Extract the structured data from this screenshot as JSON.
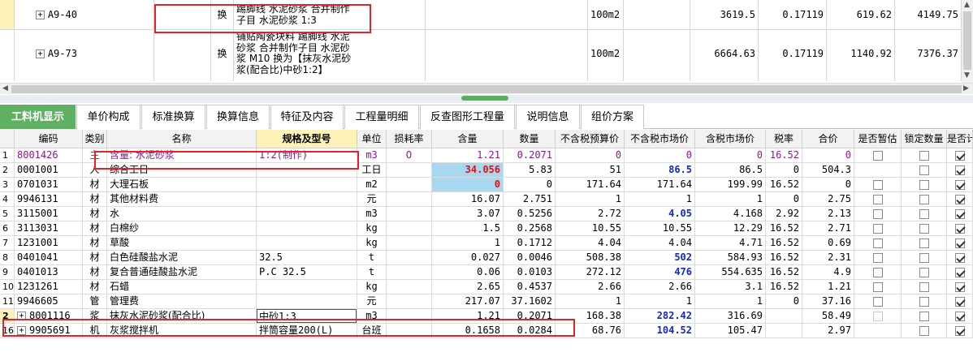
{
  "top_rows": [
    {
      "code": "A9-40",
      "type": "换",
      "name_lines": [
        "踢脚线 水泥砂浆  合并制作",
        "子目 水泥砂浆 1:3"
      ],
      "unit": "100m2",
      "price": "3619.5",
      "qty": "0.17119",
      "total": "619.62",
      "extra": "4149.75"
    },
    {
      "code": "A9-73",
      "type": "换",
      "name_lines": [
        "铺贴陶瓷块料 踢脚线 水泥",
        "砂浆  合并制作子目 水泥砂",
        "浆 M10  换为【抹灰水泥砂",
        "浆(配合比)中砂1:2】"
      ],
      "unit": "100m2",
      "price": "6664.63",
      "qty": "0.17119",
      "total": "1140.92",
      "extra": "7376.37"
    }
  ],
  "tabs": [
    "工料机显示",
    "单价构成",
    "标准换算",
    "换算信息",
    "特征及内容",
    "工程量明细",
    "反查图形工程量",
    "说明信息",
    "组价方案"
  ],
  "active_tab": 0,
  "columns": [
    "编码",
    "类别",
    "名称",
    "规格及型号",
    "单位",
    "损耗率",
    "含量",
    "数量",
    "不含税预算价",
    "不含税市场价",
    "含税市场价",
    "税率",
    "合价",
    "是否暂估",
    "锁定数量",
    "是否计"
  ],
  "rows": [
    {
      "idx": "1",
      "code": "8001426",
      "cat": "主",
      "name": "含量: 水泥砂浆",
      "spec": "1:2(制作)",
      "unit": "m3",
      "loss": "0",
      "content": "1.21",
      "qty": "0.2071",
      "budget": "0",
      "market": "0",
      "market_tax": "0",
      "tax": "16.52",
      "total": "0",
      "est": "checkbox",
      "lock": "checkbox",
      "calc": "checked",
      "style": "purple"
    },
    {
      "idx": "2",
      "code": "0001001",
      "cat": "人",
      "name": "综合工日",
      "spec": "",
      "unit": "工日",
      "loss": "",
      "content": "34.056",
      "qty": "5.83",
      "budget": "51",
      "market": "86.5",
      "market_tax": "86.5",
      "tax": "0",
      "total": "504.3",
      "est": "",
      "lock": "checkbox",
      "calc": "checked",
      "content_style": "red-cyan",
      "market_style": "blue"
    },
    {
      "idx": "3",
      "code": "0701031",
      "cat": "材",
      "name": "大理石板",
      "spec": "",
      "unit": "m2",
      "loss": "",
      "content": "0",
      "qty": "0",
      "budget": "171.64",
      "market": "171.64",
      "market_tax": "199.99",
      "tax": "16.52",
      "total": "0",
      "est": "checkbox",
      "lock": "checkbox",
      "calc": "checked",
      "content_style": "red-cyan"
    },
    {
      "idx": "4",
      "code": "9946131",
      "cat": "材",
      "name": "其他材料费",
      "spec": "",
      "unit": "元",
      "loss": "",
      "content": "16.07",
      "qty": "2.751",
      "budget": "1",
      "market": "1",
      "market_tax": "1",
      "tax": "0",
      "total": "2.75",
      "est": "checkbox",
      "lock": "checkbox",
      "calc": "checked"
    },
    {
      "idx": "5",
      "code": "3115001",
      "cat": "材",
      "name": "水",
      "spec": "",
      "unit": "m3",
      "loss": "",
      "content": "3.07",
      "qty": "0.5256",
      "budget": "2.72",
      "market": "4.05",
      "market_tax": "4.168",
      "tax": "2.92",
      "total": "2.13",
      "est": "checkbox",
      "lock": "checkbox",
      "calc": "checked",
      "market_style": "blue"
    },
    {
      "idx": "6",
      "code": "3113031",
      "cat": "材",
      "name": "白棉纱",
      "spec": "",
      "unit": "kg",
      "loss": "",
      "content": "1.5",
      "qty": "0.2568",
      "budget": "10.55",
      "market": "10.55",
      "market_tax": "12.29",
      "tax": "16.52",
      "total": "2.71",
      "est": "checkbox",
      "lock": "checkbox",
      "calc": "checked"
    },
    {
      "idx": "7",
      "code": "1231001",
      "cat": "材",
      "name": "草酸",
      "spec": "",
      "unit": "kg",
      "loss": "",
      "content": "1",
      "qty": "0.1712",
      "budget": "4.04",
      "market": "4.04",
      "market_tax": "4.71",
      "tax": "16.52",
      "total": "0.69",
      "est": "checkbox",
      "lock": "checkbox",
      "calc": "checked"
    },
    {
      "idx": "8",
      "code": "0401041",
      "cat": "材",
      "name": "白色硅酸盐水泥",
      "spec": "32.5",
      "unit": "t",
      "loss": "",
      "content": "0.027",
      "qty": "0.0046",
      "budget": "508.38",
      "market": "502",
      "market_tax": "584.93",
      "tax": "16.52",
      "total": "2.31",
      "est": "checkbox",
      "lock": "checkbox",
      "calc": "checked",
      "market_style": "blue"
    },
    {
      "idx": "9",
      "code": "0401013",
      "cat": "材",
      "name": "复合普通硅酸盐水泥",
      "spec": "P.C 32.5",
      "unit": "t",
      "loss": "",
      "content": "0.06",
      "qty": "0.0103",
      "budget": "272.12",
      "market": "476",
      "market_tax": "554.635",
      "tax": "16.52",
      "total": "4.9",
      "est": "checkbox",
      "lock": "checkbox",
      "calc": "checked",
      "market_style": "blue"
    },
    {
      "idx": "10",
      "code": "1231261",
      "cat": "材",
      "name": "石蜡",
      "spec": "",
      "unit": "kg",
      "loss": "",
      "content": "2.65",
      "qty": "0.4537",
      "budget": "2.66",
      "market": "2.66",
      "market_tax": "3.1",
      "tax": "16.52",
      "total": "1.21",
      "est": "checkbox",
      "lock": "checkbox",
      "calc": "checked"
    },
    {
      "idx": "11",
      "code": "9946605",
      "cat": "管",
      "name": "管理费",
      "spec": "",
      "unit": "元",
      "loss": "",
      "content": "217.07",
      "qty": "37.1602",
      "budget": "1",
      "market": "1",
      "market_tax": "1",
      "tax": "0",
      "total": "37.16",
      "est": "checkbox",
      "lock": "checkbox",
      "calc": "checked"
    },
    {
      "idx": "2",
      "code": "8001116",
      "cat": "浆",
      "name": "抹灰水泥砂浆(配合比)",
      "spec": "中砂1:3",
      "unit": "m3",
      "loss": "",
      "content": "1.21",
      "qty": "0.2071",
      "budget": "168.38",
      "market": "282.42",
      "market_tax": "316.69",
      "tax": "",
      "total": "58.49",
      "est": "disabled",
      "lock": "checkbox",
      "calc": "checked",
      "market_style": "blue",
      "expander": true,
      "current": true
    },
    {
      "idx": "16",
      "code": "9905691",
      "cat": "机",
      "name": "灰浆搅拌机",
      "spec": "拌筒容量200(L)",
      "unit": "台班",
      "loss": "",
      "content": "0.1658",
      "qty": "0.0284",
      "budget": "68.76",
      "market": "104.52",
      "market_tax": "105.47",
      "tax": "",
      "total": "2.97",
      "est": "",
      "lock": "checkbox",
      "calc": "checked",
      "market_style": "blue",
      "expander": true
    }
  ],
  "colors": {
    "accent_green": "#5fb063",
    "highlight_red": "#e0242c",
    "value_blue": "#1428c8"
  }
}
